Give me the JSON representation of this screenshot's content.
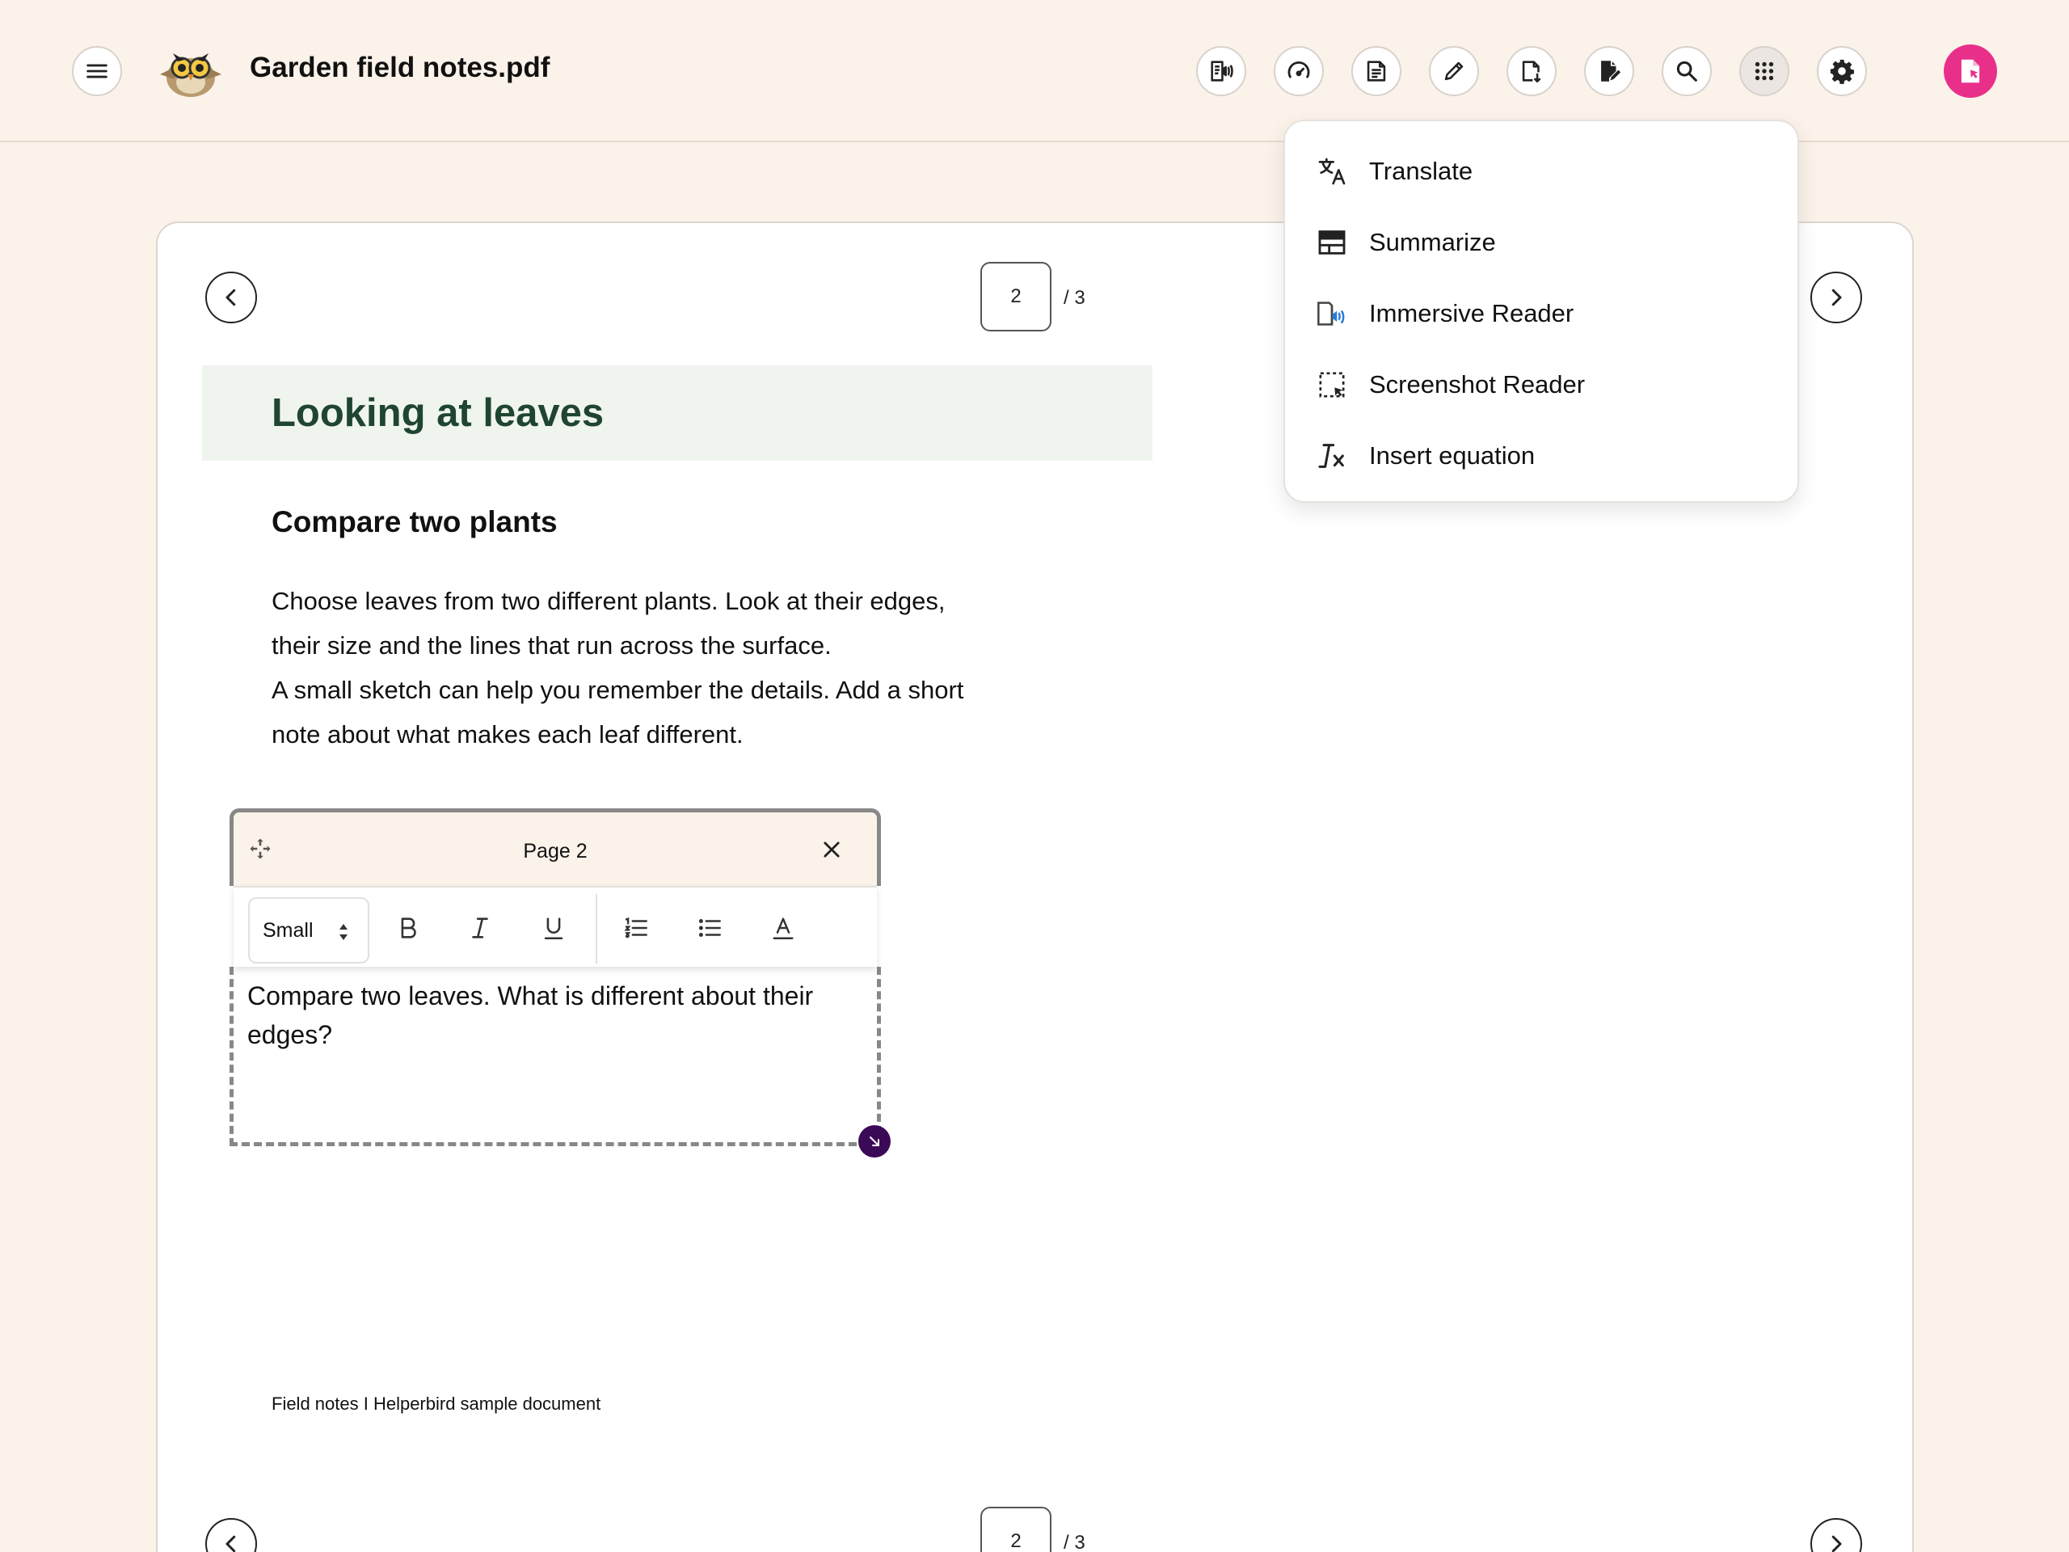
{
  "header": {
    "title": "Garden field notes.pdf",
    "toolbar_icons": [
      "text-to-speech-icon",
      "speed-icon",
      "ai-notes-icon",
      "pen-icon",
      "download-icon",
      "edit-document-icon",
      "search-icon",
      "apps-grid-icon",
      "settings-icon"
    ],
    "profile_color": "#e8308a"
  },
  "pager": {
    "current": "2",
    "total_label": "/ 3"
  },
  "document": {
    "heading": "Looking at leaves",
    "subheading": "Compare two plants",
    "paragraph_lines": [
      "Choose leaves from two different plants. Look at their edges,",
      "their size and the lines that run across the surface.",
      "A small sketch can help you remember the details. Add a short",
      "note about what makes each leaf different."
    ],
    "footer": "Field notes I Helperbird sample document"
  },
  "note": {
    "title": "Page 2",
    "font_size": "Small",
    "text_lines": [
      "Compare two leaves. What is different about their",
      "edges?"
    ]
  },
  "apps_menu": {
    "items": [
      {
        "label": "Translate",
        "icon": "translate-icon"
      },
      {
        "label": "Summarize",
        "icon": "summarize-icon"
      },
      {
        "label": "Immersive Reader",
        "icon": "immersive-reader-icon"
      },
      {
        "label": "Screenshot Reader",
        "icon": "screenshot-reader-icon"
      },
      {
        "label": "Insert equation",
        "icon": "equation-icon"
      }
    ]
  },
  "colors": {
    "background": "#fbf2ea",
    "heading_green": "#1f4530",
    "heading_band": "#f0f4ef",
    "resize_handle": "#3b0a57"
  }
}
